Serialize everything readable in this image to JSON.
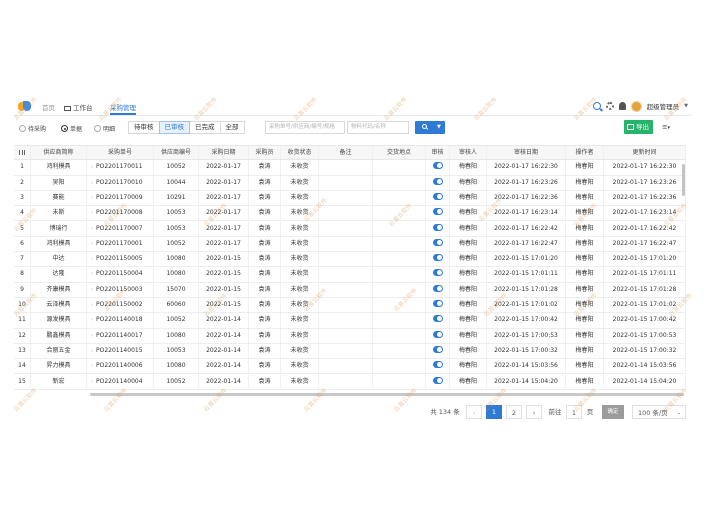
{
  "topbar": {
    "nav": [
      "首页",
      "工作台",
      "采购管理"
    ],
    "user_name": "超级管理员"
  },
  "toolbar": {
    "radios": [
      "待采购",
      "单据",
      "明细"
    ],
    "selected_radio": "单据",
    "segments": [
      "待审核",
      "已审核",
      "已完成",
      "全部"
    ],
    "selected_segment": "已审核",
    "search_placeholder": "采购单号/供应商/编号/规格",
    "search_placeholder2": "物料代码/名称",
    "export_label": "导出",
    "menu_icon": "≡"
  },
  "table": {
    "columns": [
      "",
      "供应商简称",
      "采购单号",
      "供应商编号",
      "采购日期",
      "采购员",
      "收货状态",
      "备注",
      "交货地点",
      "审核",
      "审核人",
      "审核日期",
      "操作者",
      "更新时间"
    ],
    "rows": [
      {
        "no": "1",
        "vendor": "鸿利模具",
        "po": "PO2201170011",
        "vcode": "10052",
        "date": "2022-01-17",
        "buyer": "袁涛",
        "status": "未收货",
        "auditor": "梅春阳",
        "adate": "2022-01-17 16:22:30",
        "operator": "梅春阳",
        "updated": "2022-01-17 16:22:30"
      },
      {
        "no": "2",
        "vendor": "吴阳",
        "po": "PO2201170010",
        "vcode": "10044",
        "date": "2022-01-17",
        "buyer": "袁涛",
        "status": "未收货",
        "auditor": "梅春阳",
        "adate": "2022-01-17 16:23:26",
        "operator": "梅春阳",
        "updated": "2022-01-17 16:23:26"
      },
      {
        "no": "3",
        "vendor": "赛能",
        "po": "PO2201170009",
        "vcode": "10291",
        "date": "2022-01-17",
        "buyer": "袁涛",
        "status": "未收货",
        "auditor": "梅春阳",
        "adate": "2022-01-17 16:22:36",
        "operator": "梅春阳",
        "updated": "2022-01-17 16:22:36"
      },
      {
        "no": "4",
        "vendor": "未斯",
        "po": "PO2201170008",
        "vcode": "10053",
        "date": "2022-01-17",
        "buyer": "袁涛",
        "status": "未收货",
        "auditor": "梅春阳",
        "adate": "2022-01-17 16:23:14",
        "operator": "梅春阳",
        "updated": "2022-01-17 16:23:14"
      },
      {
        "no": "5",
        "vendor": "博瑞行",
        "po": "PO2201170007",
        "vcode": "10053",
        "date": "2022-01-17",
        "buyer": "袁涛",
        "status": "未收货",
        "auditor": "梅春阳",
        "adate": "2022-01-17 16:22:42",
        "operator": "梅春阳",
        "updated": "2022-01-17 16:22:42"
      },
      {
        "no": "6",
        "vendor": "鸿利模具",
        "po": "PO2201170001",
        "vcode": "10052",
        "date": "2022-01-17",
        "buyer": "袁涛",
        "status": "未收货",
        "auditor": "梅春阳",
        "adate": "2022-01-17 16:22:47",
        "operator": "梅春阳",
        "updated": "2022-01-17 16:22:47"
      },
      {
        "no": "7",
        "vendor": "中达",
        "po": "PO2201150005",
        "vcode": "10080",
        "date": "2022-01-15",
        "buyer": "袁涛",
        "status": "未收货",
        "auditor": "梅春阳",
        "adate": "2022-01-15 17:01:20",
        "operator": "梅春阳",
        "updated": "2022-01-15 17:01:20"
      },
      {
        "no": "8",
        "vendor": "达隆",
        "po": "PO2201150004",
        "vcode": "10080",
        "date": "2022-01-15",
        "buyer": "袁涛",
        "status": "未收货",
        "auditor": "梅春阳",
        "adate": "2022-01-15 17:01:11",
        "operator": "梅春阳",
        "updated": "2022-01-15 17:01:11"
      },
      {
        "no": "9",
        "vendor": "齐康模具",
        "po": "PO2201150003",
        "vcode": "15070",
        "date": "2022-01-15",
        "buyer": "袁涛",
        "status": "未收货",
        "auditor": "梅春阳",
        "adate": "2022-01-15 17:01:28",
        "operator": "梅春阳",
        "updated": "2022-01-15 17:01:28"
      },
      {
        "no": "10",
        "vendor": "云泽模具",
        "po": "PO2201150002",
        "vcode": "60060",
        "date": "2022-01-15",
        "buyer": "袁涛",
        "status": "未收货",
        "auditor": "梅春阳",
        "adate": "2022-01-15 17:01:02",
        "operator": "梅春阳",
        "updated": "2022-01-15 17:01:02"
      },
      {
        "no": "11",
        "vendor": "源发模具",
        "po": "PO2201140018",
        "vcode": "10052",
        "date": "2022-01-14",
        "buyer": "袁涛",
        "status": "未收货",
        "auditor": "梅春阳",
        "adate": "2022-01-15 17:00:42",
        "operator": "梅春阳",
        "updated": "2022-01-15 17:00:42"
      },
      {
        "no": "12",
        "vendor": "鹏鑫模具",
        "po": "PO2201140017",
        "vcode": "10080",
        "date": "2022-01-14",
        "buyer": "袁涛",
        "status": "未收货",
        "auditor": "梅春阳",
        "adate": "2022-01-15 17:00:53",
        "operator": "梅春阳",
        "updated": "2022-01-15 17:00:53"
      },
      {
        "no": "13",
        "vendor": "合丽五金",
        "po": "PO2201140015",
        "vcode": "10053",
        "date": "2022-01-14",
        "buyer": "袁涛",
        "status": "未收货",
        "auditor": "梅春阳",
        "adate": "2022-01-15 17:00:32",
        "operator": "梅春阳",
        "updated": "2022-01-15 17:00:32"
      },
      {
        "no": "14",
        "vendor": "昇力模具",
        "po": "PO2201140006",
        "vcode": "10080",
        "date": "2022-01-14",
        "buyer": "袁涛",
        "status": "未收货",
        "auditor": "梅春阳",
        "adate": "2022-01-14 15:03:56",
        "operator": "梅春阳",
        "updated": "2022-01-14 15:03:56"
      },
      {
        "no": "15",
        "vendor": "新宏",
        "po": "PO2201140004",
        "vcode": "10052",
        "date": "2022-01-14",
        "buyer": "袁涛",
        "status": "未收货",
        "auditor": "梅春阳",
        "adate": "2022-01-14 15:04:20",
        "operator": "梅春阳",
        "updated": "2022-01-14 15:04:20"
      }
    ]
  },
  "pagination": {
    "total": "共 134 条",
    "prev": "‹",
    "pages": [
      "1",
      "2"
    ],
    "current": "1",
    "next": "›",
    "goto_label": "前往",
    "goto_value": "1",
    "page_unit": "页",
    "confirm": "确定",
    "page_size": "100 条/页"
  },
  "watermark": "云易云软件",
  "colors": {
    "primary": "#2f7ad3",
    "export": "#25b46a"
  }
}
